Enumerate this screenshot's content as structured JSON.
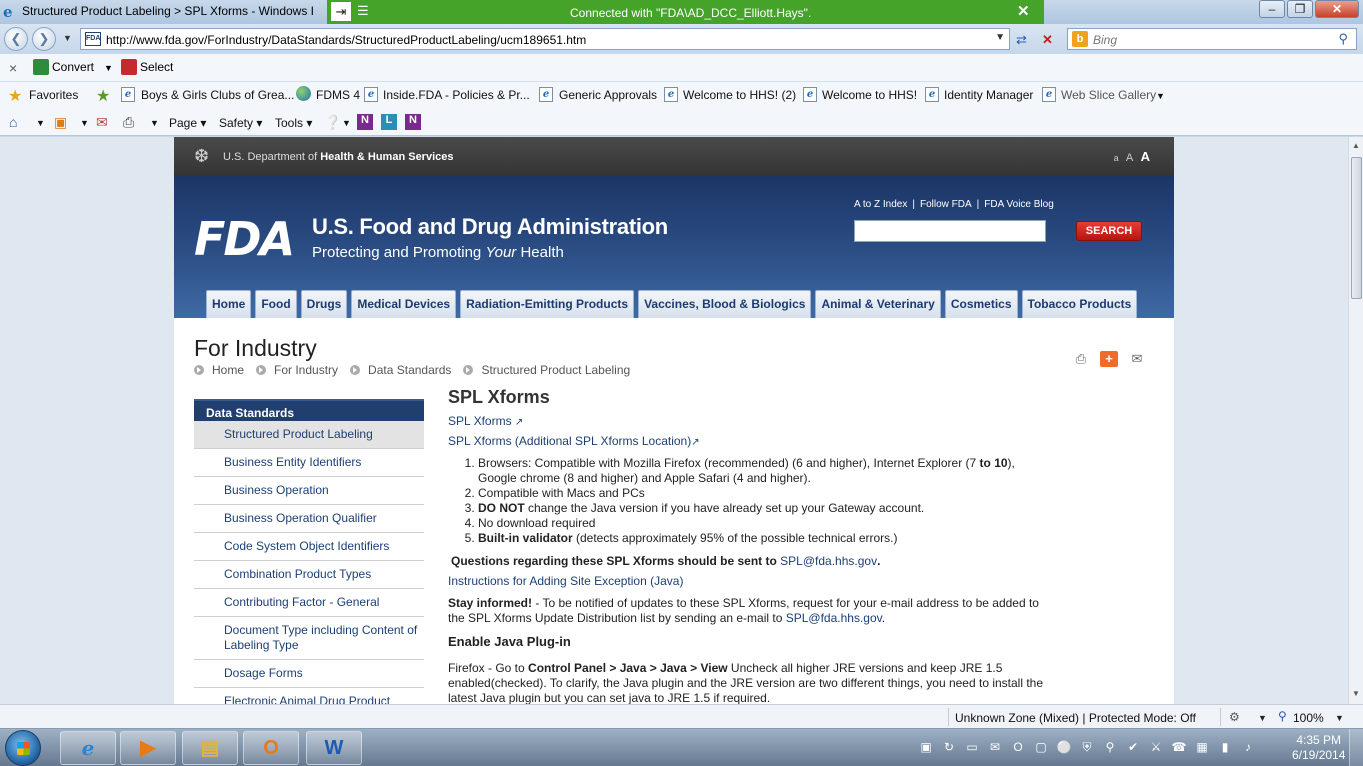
{
  "window": {
    "title": "Structured Product Labeling > SPL Xforms - Windows I",
    "remote_banner": "Connected with \"FDA\\AD_DCC_Elliott.Hays\"."
  },
  "address_bar": {
    "url": "http://www.fda.gov/ForIndustry/DataStandards/StructuredProductLabeling/ucm189651.htm",
    "favicon_text": "FDA",
    "search_placeholder": "Bing"
  },
  "convert_bar": {
    "convert_label": "Convert",
    "select_label": "Select"
  },
  "favorites_bar": {
    "favorites_label": "Favorites",
    "items": [
      "Boys & Girls Clubs of Grea...",
      "FDMS 4",
      "Inside.FDA - Policies & Pr...",
      "Generic Approvals",
      "Welcome to HHS! (2)",
      "Welcome to HHS!",
      "Identity Manager",
      "Web Slice Gallery"
    ]
  },
  "command_bar": {
    "page": "Page",
    "safety": "Safety",
    "tools": "Tools"
  },
  "hhs": {
    "dept_prefix": "U.S. Department of ",
    "dept_bold": "Health & Human Services",
    "size_small": "a",
    "size_medium": "A",
    "size_large": "A"
  },
  "fda_header": {
    "logo": "FDA",
    "agency": "U.S. Food and Drug Administration",
    "tagline_before": "Protecting and Promoting ",
    "tagline_italic": "Your",
    "tagline_after": " Health",
    "top_links": [
      "A to Z Index",
      "Follow FDA",
      "FDA Voice Blog"
    ],
    "search_button": "SEARCH",
    "nav_tabs": [
      "Home",
      "Food",
      "Drugs",
      "Medical Devices",
      "Radiation-Emitting Products",
      "Vaccines, Blood & Biologics",
      "Animal & Veterinary",
      "Cosmetics",
      "Tobacco Products"
    ]
  },
  "page": {
    "title": "For Industry",
    "breadcrumb": [
      "Home",
      "For Industry",
      "Data Standards",
      "Structured Product Labeling"
    ]
  },
  "left_nav": {
    "heading": "Data Standards",
    "items": [
      "Structured Product Labeling",
      "Business Entity Identifiers",
      "Business Operation",
      "Business Operation Qualifier",
      "Code System Object Identifiers",
      "Combination Product Types",
      "Contributing Factor - General",
      "Document Type including Content of Labeling Type",
      "Dosage Forms",
      "Electronic Animal Drug Product Listing Directory"
    ]
  },
  "content": {
    "heading": "SPL Xforms",
    "link1": "SPL Xforms",
    "link2": "SPL Xforms (Additional SPL Xforms Location)",
    "list": {
      "item1_text": "Browsers:  Compatible with Mozilla Firefox (recommended) (6 and higher), Internet Explorer (7 ",
      "item1_bold": "to 10",
      "item1_after": "), Google chrome (8 and higher) and Apple Safari (4 and higher).",
      "item2": "Compatible with Macs and PCs",
      "item3_bold": "DO NOT",
      "item3_after": " change the Java version if you have already set up your Gateway account.",
      "item4": "No download required",
      "item5_bold": "Built-in validator",
      "item5_after": " (detects approximately 95% of the possible technical errors.)"
    },
    "question_text": "Questions regarding these SPL Xforms should be sent to ",
    "question_email": "SPL@fda.hhs.gov",
    "question_end": ".",
    "instructions_link": "Instructions for Adding Site Exception (Java)",
    "stay_bold": "Stay informed!",
    "stay_text": "  - To be notified of updates to these SPL Xforms, request for your e-mail address to be added to the SPL Xforms Update Distribution list by sending an e-mail to  ",
    "stay_email": "SPL@fda.hhs.gov",
    "stay_end": ".",
    "java_heading": "Enable Java Plug-in",
    "firefox_prefix": "Firefox - Go to ",
    "firefox_bold": "Control Panel > Java > Java > View",
    "firefox_after": " Uncheck all higher JRE versions and keep JRE 1.5 enabled(checked). To clarify, the Java plugin and the JRE version are two different things, you need to install the latest Java plugin but you can set java to JRE 1.5 if required."
  },
  "status_bar": {
    "zone": "Unknown Zone (Mixed) | Protected Mode: Off",
    "zoom": "100%"
  },
  "taskbar": {
    "time": "4:35 PM",
    "date": "6/19/2014"
  }
}
